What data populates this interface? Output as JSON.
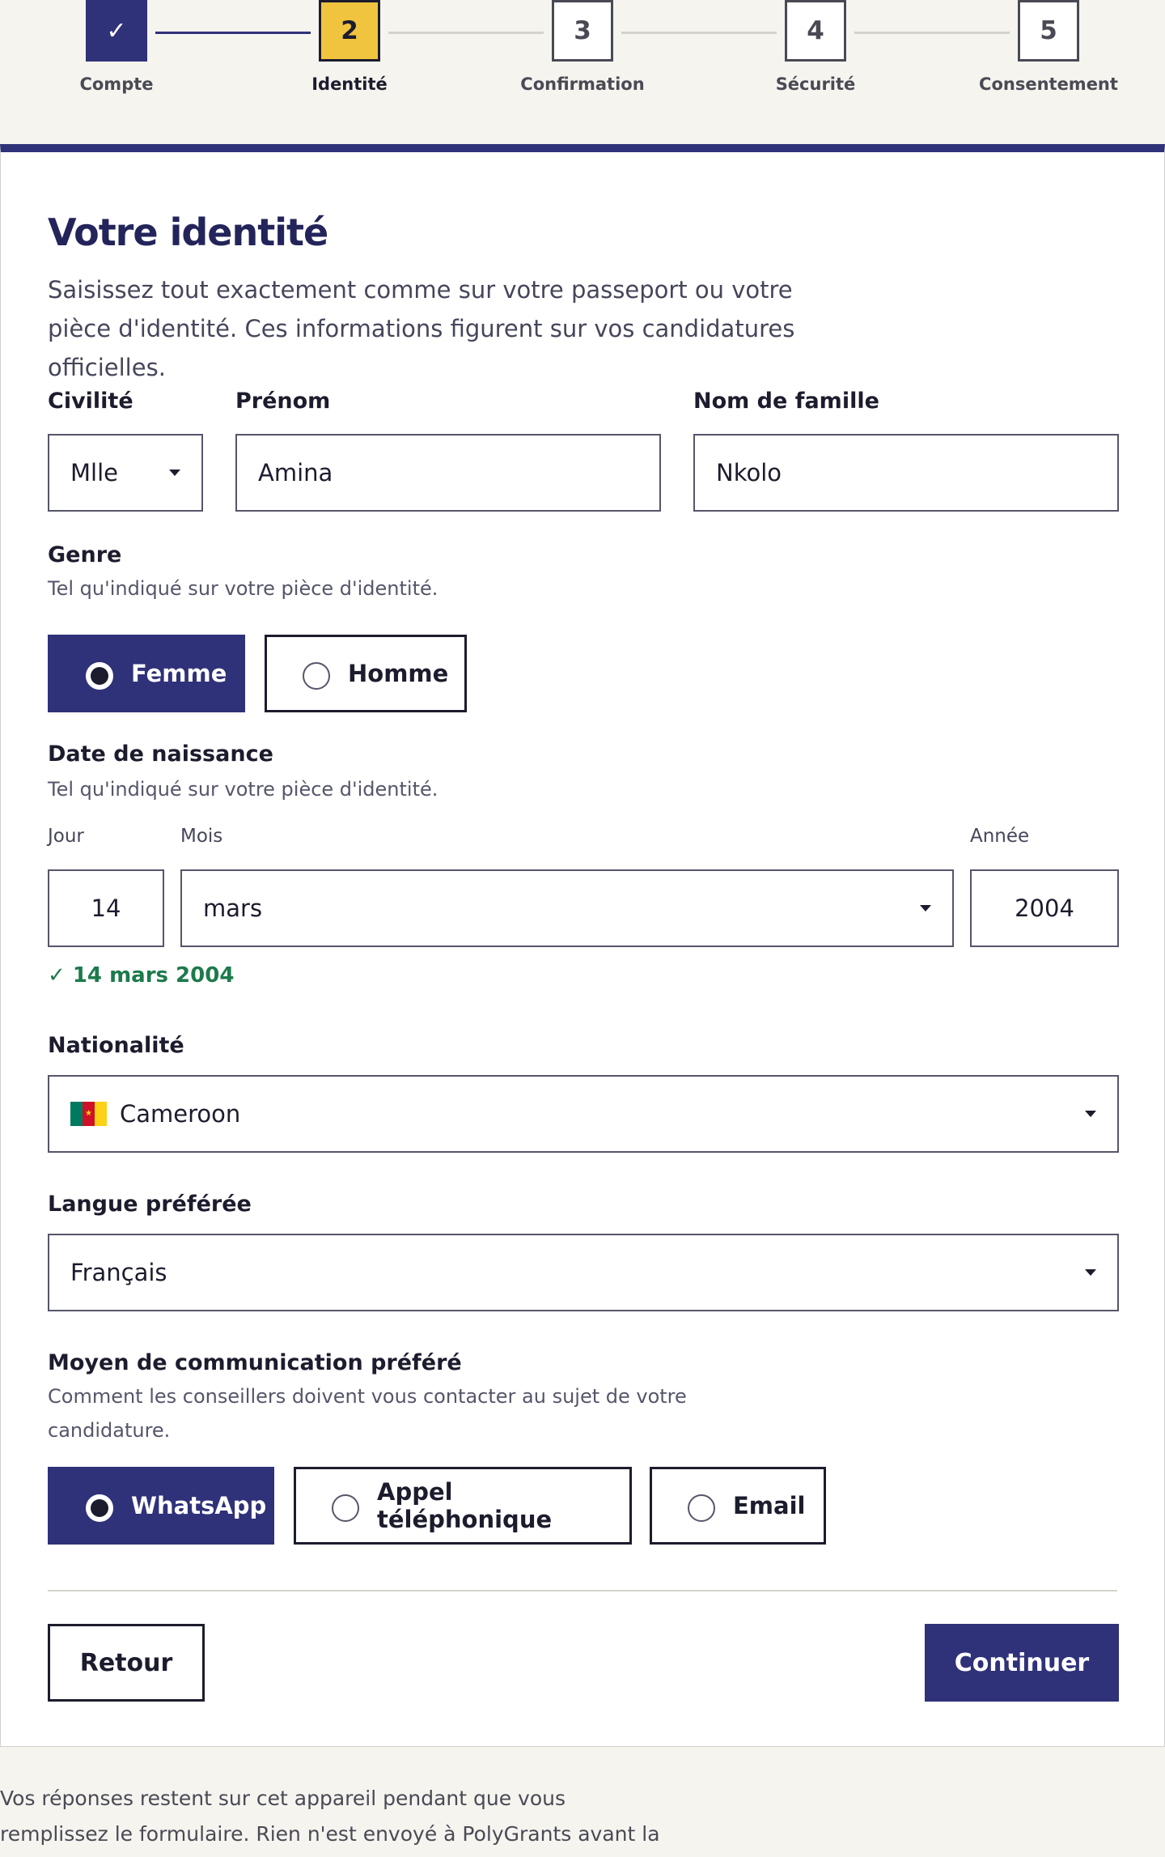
{
  "stepper": {
    "steps": [
      {
        "number": "",
        "label": "Compte",
        "state": "done"
      },
      {
        "number": "2",
        "label": "Identité",
        "state": "current"
      },
      {
        "number": "3",
        "label": "Confirmation",
        "state": "upcoming"
      },
      {
        "number": "4",
        "label": "Sécurité",
        "state": "upcoming"
      },
      {
        "number": "5",
        "label": "Consentement",
        "state": "upcoming"
      }
    ],
    "done_icon": "✓"
  },
  "form": {
    "title": "Votre identité",
    "lead": "Saisissez tout exactement comme sur votre passeport ou votre pièce d'identité. Ces informations figurent sur vos candidatures officielles.",
    "civility": {
      "label": "Civilité",
      "value": "Mlle"
    },
    "first_name": {
      "label": "Prénom",
      "value": "Amina"
    },
    "last_name": {
      "label": "Nom de famille",
      "value": "Nkolo"
    },
    "gender": {
      "label": "Genre",
      "hint": "Tel qu'indiqué sur votre pièce d'identité.",
      "options": [
        {
          "label": "Femme",
          "selected": true
        },
        {
          "label": "Homme",
          "selected": false
        }
      ]
    },
    "birth_date": {
      "label": "Date de naissance",
      "hint": "Tel qu'indiqué sur votre pièce d'identité.",
      "day_label": "Jour",
      "month_label": "Mois",
      "year_label": "Année",
      "day": "14",
      "month": "mars",
      "year": "2004",
      "confirmation": "✓ 14 mars 2004"
    },
    "nationality": {
      "label": "Nationalité",
      "value": "Cameroon",
      "flag": "cameroon-flag"
    },
    "language": {
      "label": "Langue préférée",
      "value": "Français"
    },
    "contact": {
      "label": "Moyen de communication préféré",
      "hint": "Comment les conseillers doivent vous contacter au sujet de votre candidature.",
      "options": [
        {
          "label": "WhatsApp",
          "selected": true
        },
        {
          "label": "Appel téléphonique",
          "selected": false
        },
        {
          "label": "Email",
          "selected": false
        }
      ]
    },
    "back_label": "Retour",
    "continue_label": "Continuer"
  },
  "colors": {
    "primary": "#2f3179",
    "current_step": "#f0c43e",
    "success": "#1d7a4b",
    "page_bg": "#f5f4ef"
  },
  "footnote": "Vos réponses restent sur cet appareil pendant que vous remplissez le formulaire. Rien n'est envoyé à PolyGrants avant la dernière étape."
}
